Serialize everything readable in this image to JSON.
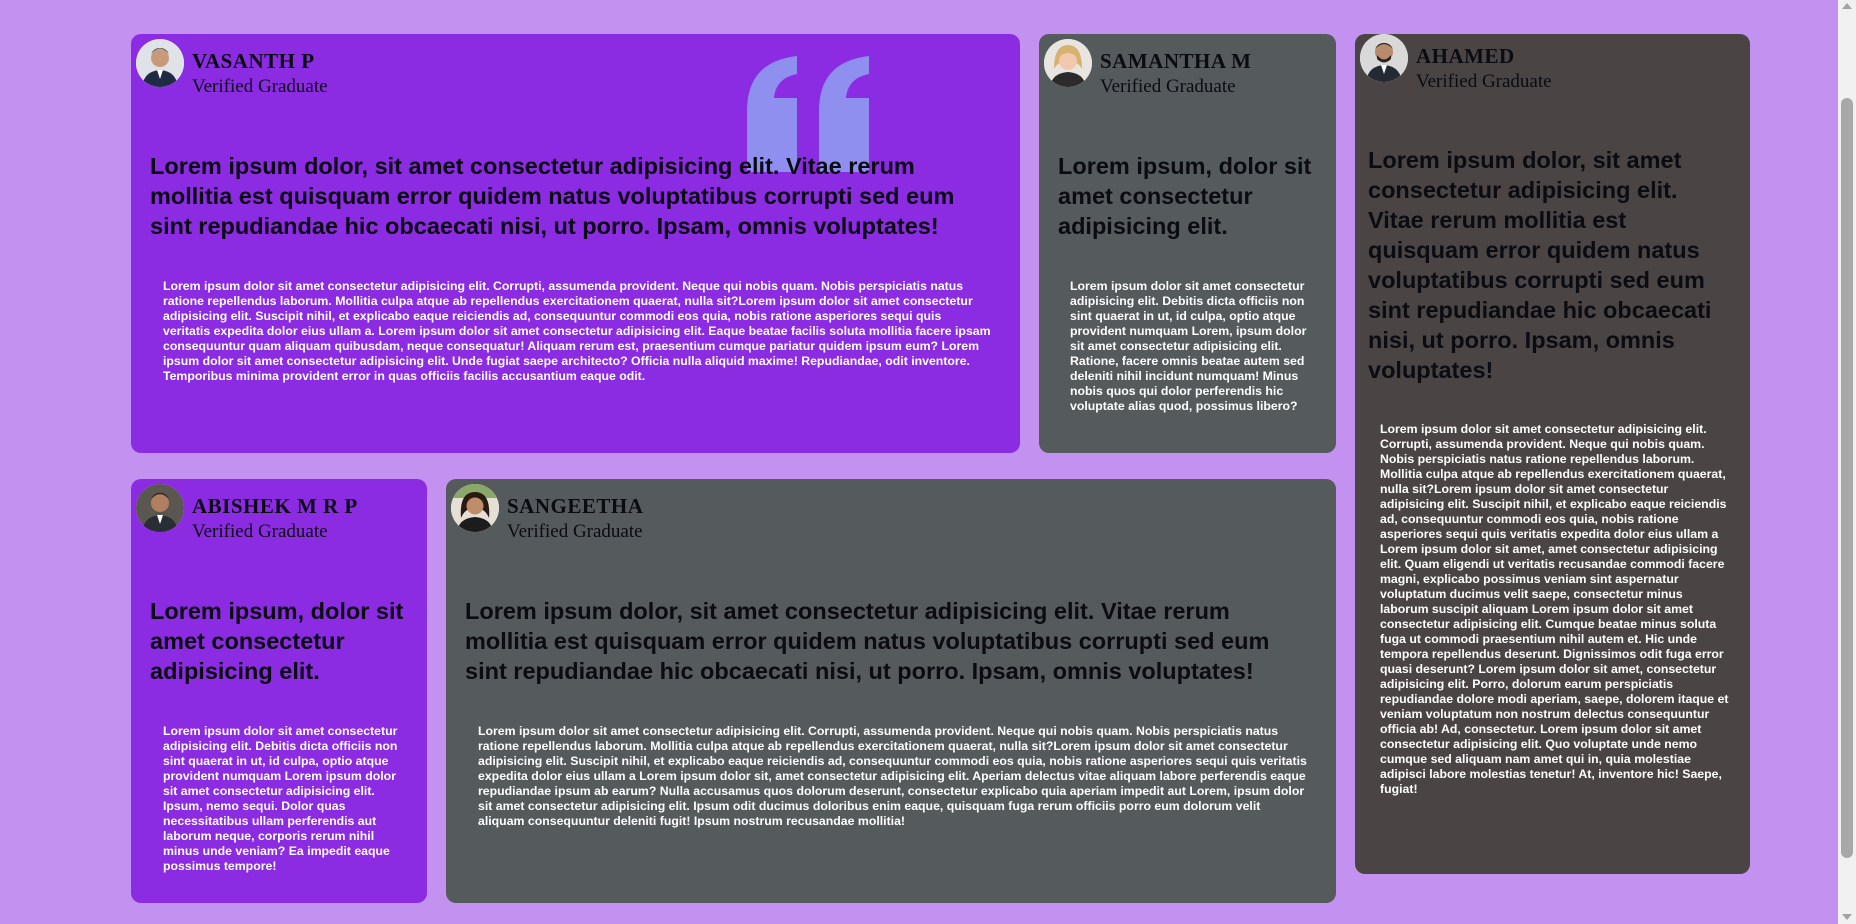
{
  "colors": {
    "page_bg": "#c392f0",
    "purple_card": "#8b2be2",
    "grey_card": "#555a5c",
    "brown_card": "#4a4444",
    "quote_mark": "#8f8ff0"
  },
  "decoration": {
    "quote_icon": "quote-mark-icon"
  },
  "cards": [
    {
      "name": "VASANTH P",
      "role": "Verified Graduate",
      "quote": "Lorem ipsum dolor, sit amet consectetur adipisicing elit. Vitae rerum mollitia est quisquam error quidem natus voluptatibus corrupti sed eum sint repudiandae hic obcaecati nisi, ut porro. Ipsam, omnis voluptates!",
      "body": "Lorem ipsum dolor sit amet consectetur adipisicing elit. Corrupti, assumenda provident. Neque qui nobis quam. Nobis perspiciatis natus ratione repellendus laborum. Mollitia culpa atque ab repellendus exercitationem quaerat, nulla sit?Lorem ipsum dolor sit amet consectetur adipisicing elit. Suscipit nihil, et explicabo eaque reiciendis ad, consequuntur commodi eos quia, nobis ratione asperiores sequi quis veritatis expedita dolor eius ullam a. Lorem ipsum dolor sit amet consectetur adipisicing elit. Eaque beatae facilis soluta mollitia facere ipsam consequuntur quam aliquam quibusdam, neque consequatur! Aliquam rerum est, praesentium cumque pariatur quidem ipsum eum? Lorem ipsum dolor sit amet consectetur adipisicing elit. Unde fugiat saepe architecto? Officia nulla aliquid maxime! Repudiandae, odit inventore. Temporibus minima provident error in quas officiis facilis accusantium eaque odit."
    },
    {
      "name": "SAMANTHA M",
      "role": "Verified Graduate",
      "quote": "Lorem ipsum, dolor sit amet consectetur adipisicing elit.",
      "body": "Lorem ipsum dolor sit amet consectetur adipisicing elit. Debitis dicta officiis non sint quaerat in ut, id culpa, optio atque provident numquam Lorem, ipsum dolor sit amet consectetur adipisicing elit. Ratione, facere omnis beatae autem sed deleniti nihil incidunt numquam! Minus nobis quos qui dolor perferendis hic voluptate alias quod, possimus libero?"
    },
    {
      "name": "AHAMED",
      "role": "Verified Graduate",
      "quote": "Lorem ipsum dolor, sit amet consectetur adipisicing elit. Vitae rerum mollitia est quisquam error quidem natus voluptatibus corrupti sed eum sint repudiandae hic obcaecati nisi, ut porro. Ipsam, omnis voluptates!",
      "body": "Lorem ipsum dolor sit amet consectetur adipisicing elit. Corrupti, assumenda provident. Neque qui nobis quam. Nobis perspiciatis natus ratione repellendus laborum. Mollitia culpa atque ab repellendus exercitationem quaerat, nulla sit?Lorem ipsum dolor sit amet consectetur adipisicing elit. Suscipit nihil, et explicabo eaque reiciendis ad, consequuntur commodi eos quia, nobis ratione asperiores sequi quis veritatis expedita dolor eius ullam a Lorem ipsum dolor sit amet, amet consectetur adipisicing elit. Quam eligendi ut veritatis recusandae commodi facere magni, explicabo possimus veniam sint aspernatur voluptatum ducimus velit saepe, consectetur minus laborum suscipit aliquam Lorem ipsum dolor sit amet consectetur adipisicing elit. Cumque beatae minus soluta fuga ut commodi praesentium nihil autem et. Hic unde tempora repellendus deserunt. Dignissimos odit fuga error quasi deserunt? Lorem ipsum dolor sit amet, consectetur adipisicing elit. Porro, dolorum earum perspiciatis repudiandae dolore modi aperiam, saepe, dolorem itaque et veniam voluptatum non nostrum delectus consequuntur officia ab! Ad, consectetur. Lorem ipsum dolor sit amet consectetur adipisicing elit. Quo voluptate unde nemo cumque sed aliquam nam amet qui in, quia molestiae adipisci labore molestias tenetur! At, inventore hic! Saepe, fugiat!"
    },
    {
      "name": "ABISHEK M R P",
      "role": "Verified Graduate",
      "quote": "Lorem ipsum, dolor sit amet consectetur adipisicing elit.",
      "body": "Lorem ipsum dolor sit amet consectetur adipisicing elit. Debitis dicta officiis non sint quaerat in ut, id culpa, optio atque provident numquam Lorem ipsum dolor sit amet consectetur adipisicing elit. Ipsum, nemo sequi. Dolor quas necessitatibus ullam perferendis aut laborum neque, corporis rerum nihil minus unde veniam? Ea impedit eaque possimus tempore!"
    },
    {
      "name": "SANGEETHA",
      "role": "Verified Graduate",
      "quote": "Lorem ipsum dolor, sit amet consectetur adipisicing elit. Vitae rerum mollitia est quisquam error quidem natus voluptatibus corrupti sed eum sint repudiandae hic obcaecati nisi, ut porro. Ipsam, omnis voluptates!",
      "body": "Lorem ipsum dolor sit amet consectetur adipisicing elit. Corrupti, assumenda provident. Neque qui nobis quam. Nobis perspiciatis natus ratione repellendus laborum. Mollitia culpa atque ab repellendus exercitationem quaerat, nulla sit?Lorem ipsum dolor sit amet consectetur adipisicing elit. Suscipit nihil, et explicabo eaque reiciendis ad, consequuntur commodi eos quia, nobis ratione asperiores sequi quis veritatis expedita dolor eius ullam a Lorem ipsum dolor sit, amet consectetur adipisicing elit. Aperiam delectus vitae aliquam labore perferendis eaque repudiandae ipsum ab earum? Nulla accusamus quos dolorum deserunt, consectetur explicabo quia aperiam impedit aut Lorem, ipsum dolor sit amet consectetur adipisicing elit. Ipsum odit ducimus doloribus enim eaque, quisquam fuga rerum officiis porro eum dolorum velit aliquam consequuntur deleniti fugit! Ipsum nostrum recusandae mollitia!"
    }
  ]
}
